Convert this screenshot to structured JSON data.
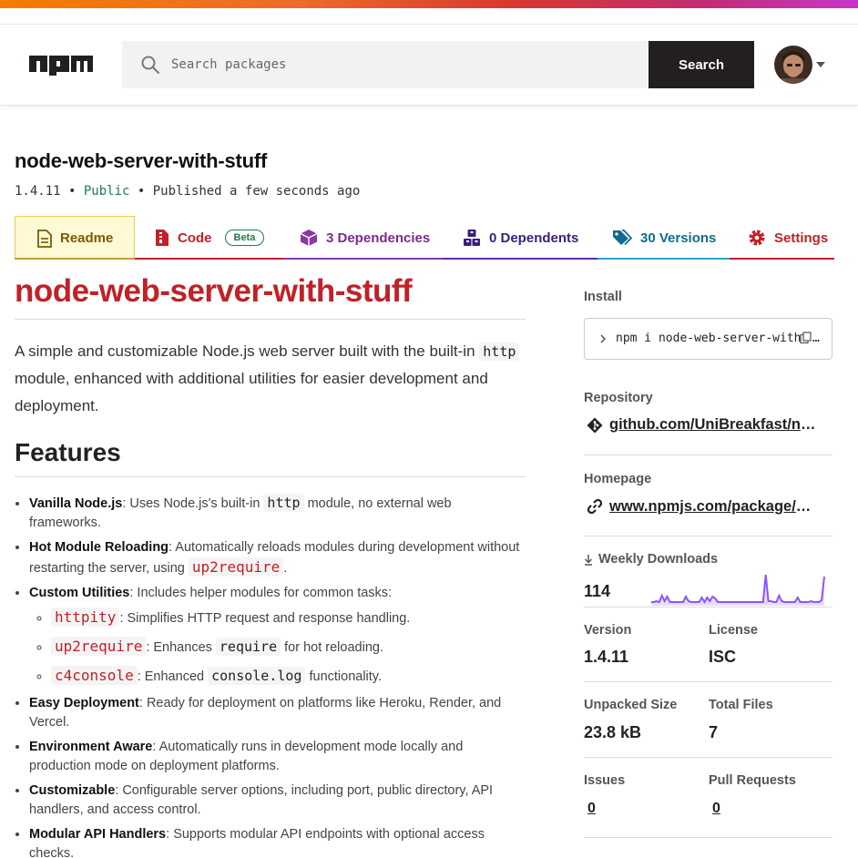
{
  "header": {
    "logo": "npm",
    "search": {
      "placeholder": "Search packages",
      "value": ""
    },
    "search_button": "Search",
    "colors": {
      "gradient_start": "#f57c00",
      "gradient_end": "#c736c9",
      "button": "#231f20"
    }
  },
  "package": {
    "name": "node-web-server-with-stuff",
    "version": "1.4.11",
    "visibility": "Public",
    "published": "Published a few seconds ago"
  },
  "tabs": [
    {
      "label": "Readme",
      "icon": "document-icon"
    },
    {
      "label": "Code",
      "icon": "file-code-icon",
      "badge": "Beta"
    },
    {
      "label": "3 Dependencies",
      "icon": "box-icon"
    },
    {
      "label": "0 Dependents",
      "icon": "boxes-icon"
    },
    {
      "label": "30 Versions",
      "icon": "tags-icon"
    },
    {
      "label": "Settings",
      "icon": "gear-icon"
    }
  ],
  "readme": {
    "title": "node-web-server-with-stuff",
    "intro_1": "A simple and customizable Node.js web server built with the built-in",
    "intro_code": "http",
    "intro_2": "module, enhanced with additional utilities for easier development and deployment.",
    "features_heading": "Features",
    "features": [
      {
        "title": "Vanilla Node.js",
        "text_1": ": Uses Node.js's built-in ",
        "code": "http",
        "text_2": " module, no external web frameworks."
      },
      {
        "title": "Hot Module Reloading",
        "text_1": ": Automatically reloads modules during development without restarting the server, using ",
        "code": "up2require",
        "text_2": "."
      },
      {
        "title": "Custom Utilities",
        "text_1": ": Includes helper modules for common tasks:",
        "sub": [
          {
            "code": "httpity",
            "text": ": Simplifies HTTP request and response handling."
          },
          {
            "code": "up2require",
            "text_1": ": Enhances ",
            "code2": "require",
            "text_2": " for hot reloading."
          },
          {
            "code": "c4console",
            "text_1": ": Enhanced ",
            "code2": "console.log",
            "text_2": " functionality."
          }
        ]
      },
      {
        "title": "Easy Deployment",
        "text_1": ": Ready for deployment on platforms like Heroku, Render, and Vercel."
      },
      {
        "title": "Environment Aware",
        "text_1": ": Automatically runs in development mode locally and production mode on deployment platforms."
      },
      {
        "title": "Customizable",
        "text_1": ": Configurable server options, including port, public directory, API handlers, and access control."
      },
      {
        "title": "Modular API Handlers",
        "text_1": ": Supports modular API endpoints with optional access checks."
      }
    ]
  },
  "sidebar": {
    "install_label": "Install",
    "install_command": "npm i node-web-server-with-stuff",
    "repository_label": "Repository",
    "repository_link": "github.com/UniBreakfast/node-web-server-with-stuff",
    "homepage_label": "Homepage",
    "homepage_link": "www.npmjs.com/package/node-web-server-with-stuff",
    "weekly_downloads_label": "Weekly Downloads",
    "weekly_downloads": "114",
    "sparkline": [
      2,
      2,
      3,
      2,
      9,
      3,
      8,
      2,
      2,
      2,
      2,
      2,
      2,
      8,
      3,
      2,
      2,
      2,
      2,
      7,
      2,
      7,
      3,
      8,
      6,
      2,
      2,
      2,
      2,
      2,
      2,
      2,
      2,
      2,
      2,
      2,
      2,
      2,
      2,
      2,
      2,
      2,
      2,
      32,
      3,
      3,
      2,
      2,
      9,
      3,
      2,
      2,
      2,
      2,
      2,
      7,
      2,
      2,
      2,
      2,
      3,
      2,
      2,
      2,
      4,
      30
    ],
    "version_label": "Version",
    "version": "1.4.11",
    "license_label": "License",
    "license": "ISC",
    "unpacked_size_label": "Unpacked Size",
    "unpacked_size": "23.8 kB",
    "total_files_label": "Total Files",
    "total_files": "7",
    "issues_label": "Issues",
    "issues": "0",
    "pull_requests_label": "Pull Requests",
    "pull_requests": "0",
    "sparkline_color": "#8956ff"
  }
}
